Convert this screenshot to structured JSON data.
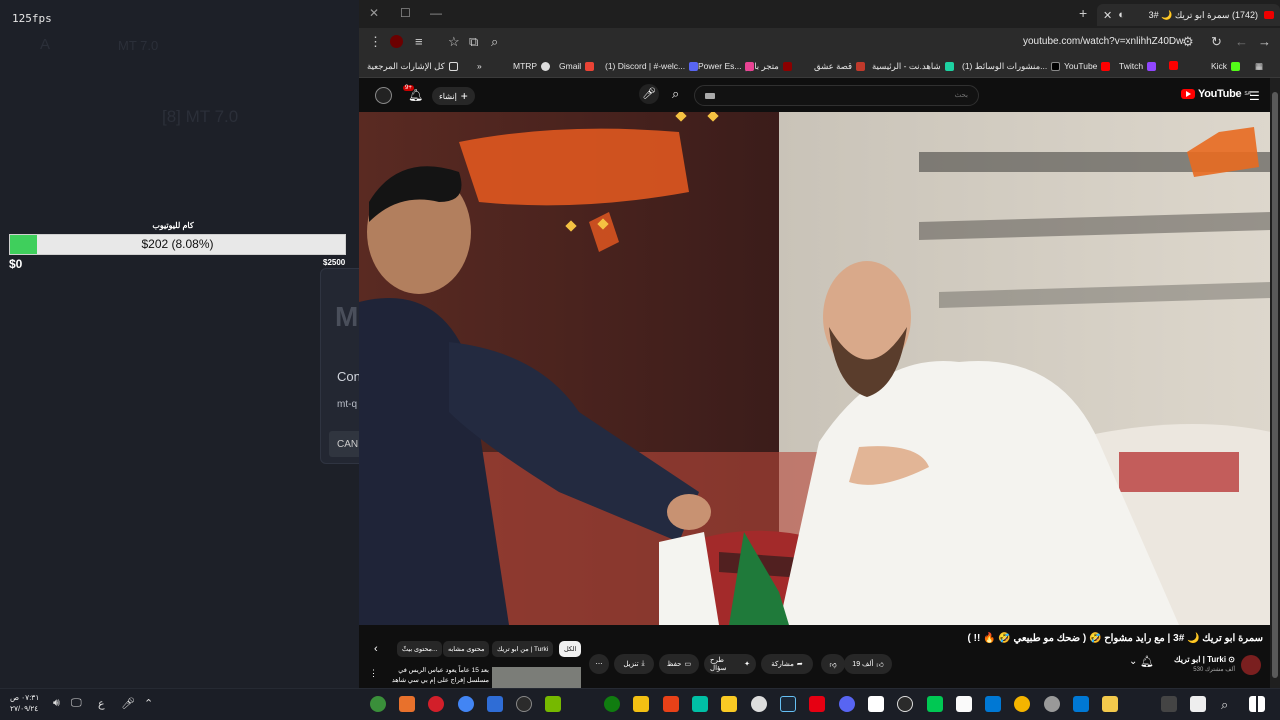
{
  "overlay": {
    "fps": "125fps",
    "goal_title": "كام لليوتيوب",
    "goal_text": "$202 (8.08%)",
    "goal_progress": 0.0808,
    "goal_min": "$0",
    "goal_max": "$2500",
    "ghost_title": "[8] MT 7.0",
    "ghost_small": "MT 7.0",
    "dialog_logo": "M",
    "dialog_title": "Con",
    "dialog_sub": "mt-q",
    "dialog_cancel": "CAN"
  },
  "browser": {
    "tab_title": "(1742) سمرة ابو تريك 🌙 #3",
    "url": "youtube.com/watch?v=xnlihhZ40Dw",
    "bookmarks": [
      {
        "label": "Kick",
        "color": "#53fc18"
      },
      {
        "label": "",
        "color": "#ff0000"
      },
      {
        "label": "Twitch",
        "color": "#9146ff"
      },
      {
        "label": "YouTube",
        "color": "#ff0000"
      },
      {
        "label": "(1) منشورات الوسائط...",
        "color": "#000000"
      },
      {
        "label": "شاهد.نت - الرئيسية",
        "color": "#1dd1a1"
      },
      {
        "label": "قصة عشق",
        "color": "#c0392b"
      },
      {
        "label": "متجر باور",
        "color": "#8b0000"
      },
      {
        "label": "Power Es...",
        "color": "#e84393"
      },
      {
        "label": "(1) Discord | #-welc...",
        "color": "#5865f2"
      },
      {
        "label": "Gmail",
        "color": "#ea4335"
      },
      {
        "label": "MTRP",
        "color": "#dddddd"
      },
      {
        "label": "»",
        "color": ""
      },
      {
        "label": "كل الإشارات المرجعية",
        "color": ""
      }
    ]
  },
  "youtube": {
    "logo_text": "YouTube",
    "logo_region": "SA",
    "search_placeholder": "بحث",
    "create_label": "إنشاء",
    "notif_count": "9+",
    "video_title": "سمرة ابو تريك 🌙 #3 | مع رايد مشواح 🤣 ( ضحك مو طبيعي 🤣 🔥 !! )",
    "channel_name": "ابو تريك | Turki ⊙",
    "channel_subs": "530 ألف مشترك",
    "likes": "19 ألف",
    "actions": {
      "share": "مشاركة",
      "ask": "طرح سؤال",
      "save": "حفظ",
      "download": "تنزيل"
    },
    "chips": [
      "الكل",
      "من ابو تريك | Turki",
      "محتوى مشابه",
      "محتوى بيثّ..."
    ],
    "recommendation": "بعد 15 عاماً يعود عباس الريس في مسلسل إفراج على إم بي سي شاهد"
  },
  "taskbar": {
    "time": "٠٧:٣١ ص",
    "date": "٢٧/٠٩/٢٤",
    "lang": "ع"
  }
}
